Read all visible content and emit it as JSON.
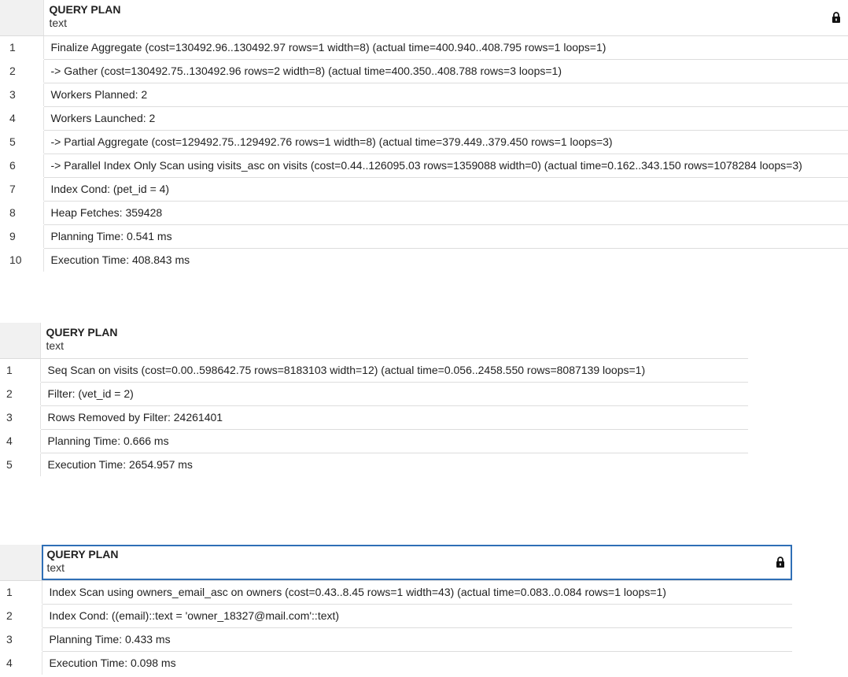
{
  "results": [
    {
      "column_title": "QUERY PLAN",
      "column_type": "text",
      "lock_icon": "lock-icon",
      "rows": [
        {
          "num": "1",
          "text": "Finalize Aggregate (cost=130492.96..130492.97 rows=1 width=8) (actual time=400.940..408.795 rows=1 loops=1)"
        },
        {
          "num": "2",
          "text": "-> Gather (cost=130492.75..130492.96 rows=2 width=8) (actual time=400.350..408.788 rows=3 loops=1)"
        },
        {
          "num": "3",
          "text": "Workers Planned: 2"
        },
        {
          "num": "4",
          "text": "Workers Launched: 2"
        },
        {
          "num": "5",
          "text": "-> Partial Aggregate (cost=129492.75..129492.76 rows=1 width=8) (actual time=379.449..379.450 rows=1 loops=3)"
        },
        {
          "num": "6",
          "text": "-> Parallel Index Only Scan using visits_asc on visits (cost=0.44..126095.03 rows=1359088 width=0) (actual time=0.162..343.150 rows=1078284 loops=3)"
        },
        {
          "num": "7",
          "text": "Index Cond: (pet_id = 4)"
        },
        {
          "num": "8",
          "text": "Heap Fetches: 359428"
        },
        {
          "num": "9",
          "text": "Planning Time: 0.541 ms"
        },
        {
          "num": "10",
          "text": "Execution Time: 408.843 ms"
        }
      ]
    },
    {
      "column_title": "QUERY PLAN",
      "column_type": "text",
      "rows": [
        {
          "num": "1",
          "text": "Seq Scan on visits (cost=0.00..598642.75 rows=8183103 width=12) (actual time=0.056..2458.550 rows=8087139 loops=1)"
        },
        {
          "num": "2",
          "text": "Filter: (vet_id = 2)"
        },
        {
          "num": "3",
          "text": "Rows Removed by Filter: 24261401"
        },
        {
          "num": "4",
          "text": "Planning Time: 0.666 ms"
        },
        {
          "num": "5",
          "text": "Execution Time: 2654.957 ms"
        }
      ]
    },
    {
      "column_title": "QUERY PLAN",
      "column_type": "text",
      "lock_icon": "lock-icon",
      "selected_header": true,
      "rows": [
        {
          "num": "1",
          "text": "Index Scan using owners_email_asc on owners (cost=0.43..8.45 rows=1 width=43) (actual time=0.083..0.084 rows=1 loops=1)"
        },
        {
          "num": "2",
          "text": "Index Cond: ((email)::text = 'owner_18327@mail.com'::text)"
        },
        {
          "num": "3",
          "text": "Planning Time: 0.433 ms"
        },
        {
          "num": "4",
          "text": "Execution Time: 0.098 ms"
        }
      ]
    }
  ],
  "colors": {
    "header_row_bg": "#f1f1f1",
    "grid_line": "#dddddd",
    "selection_border": "#2f6fb6"
  }
}
